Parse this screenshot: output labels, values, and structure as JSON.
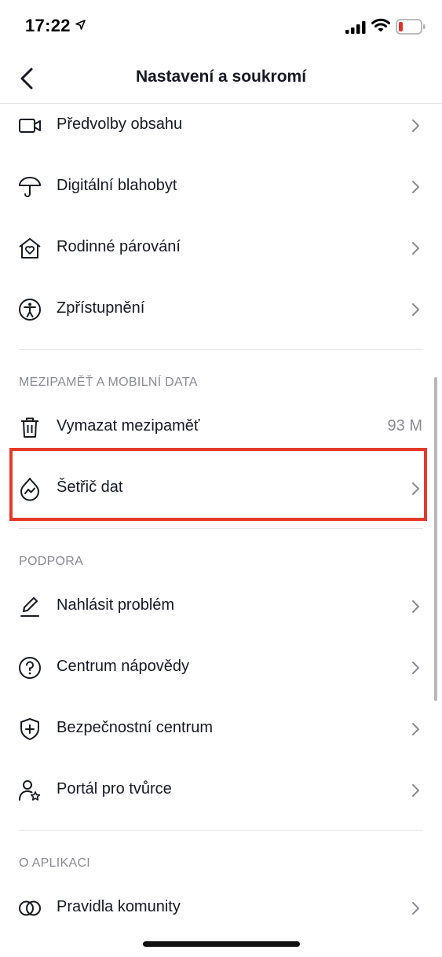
{
  "status_bar": {
    "time": "17:22"
  },
  "nav": {
    "title": "Nastavení a soukromí",
    "back_icon": "chevron-left-icon"
  },
  "items_top": [
    {
      "label": "Předvolby obsahu",
      "icon": "video-camera-icon"
    },
    {
      "label": "Digitální blahobyt",
      "icon": "umbrella-icon"
    },
    {
      "label": "Rodinné párování",
      "icon": "house-heart-icon"
    },
    {
      "label": "Zpřístupnění",
      "icon": "accessibility-icon"
    }
  ],
  "section_cache": {
    "title": "MEZIPAMĚŤ A MOBILNÍ DATA",
    "items": [
      {
        "label": "Vymazat mezipaměť",
        "icon": "trash-icon",
        "value": "93 M"
      },
      {
        "label": "Šetřič dat",
        "icon": "data-drop-icon"
      }
    ]
  },
  "section_support": {
    "title": "PODPORA",
    "items": [
      {
        "label": "Nahlásit problém",
        "icon": "pencil-icon"
      },
      {
        "label": "Centrum nápovědy",
        "icon": "question-circle-icon"
      },
      {
        "label": "Bezpečnostní centrum",
        "icon": "shield-plus-icon"
      },
      {
        "label": "Portál pro tvůrce",
        "icon": "user-star-icon"
      }
    ]
  },
  "section_about": {
    "title": "O APLIKACI",
    "items": [
      {
        "label": "Pravidla komunity",
        "icon": "rings-icon"
      }
    ]
  },
  "colors": {
    "highlight": "#e5392c",
    "text": "#161823",
    "secondary": "#8a8b91",
    "divider": "#e3e3e4"
  }
}
